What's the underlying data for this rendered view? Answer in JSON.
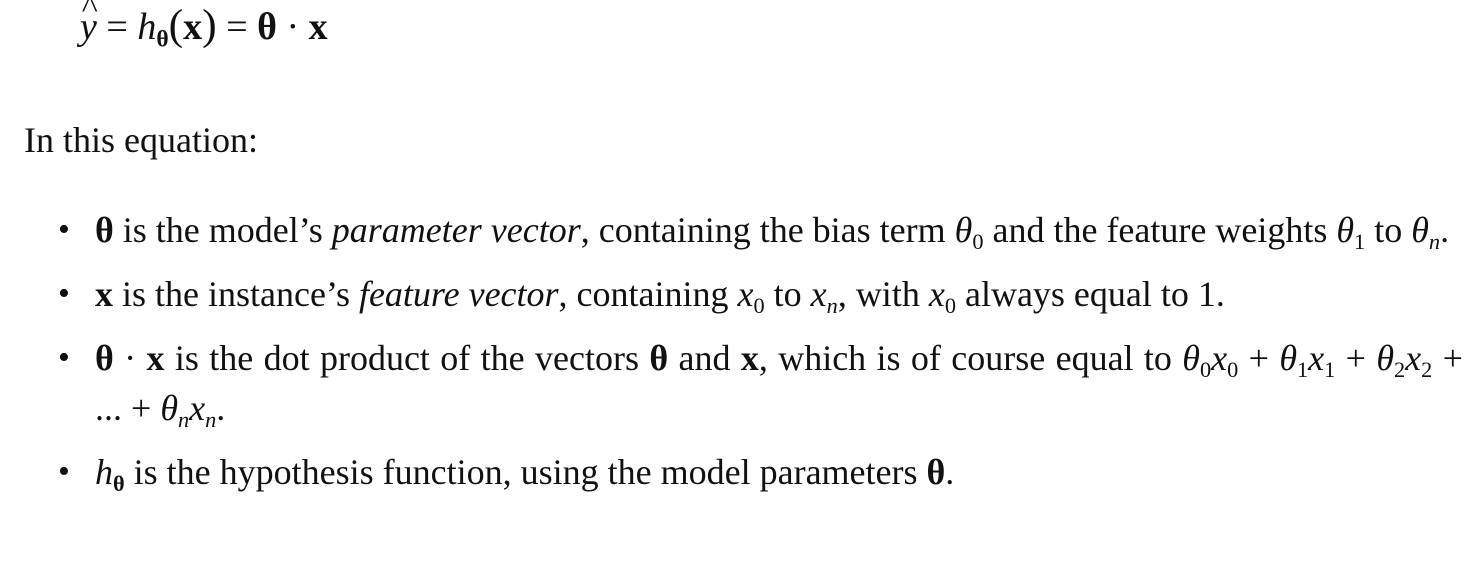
{
  "equation": {
    "y_hat": "y",
    "hat_mark": "^",
    "eq1": " = ",
    "h": "h",
    "h_sub": "θ",
    "open_paren": "(",
    "x": "x",
    "close_paren": ")",
    "eq2": " = ",
    "theta": "θ",
    "dot": " · ",
    "x2": "x"
  },
  "intro": "In this equation:",
  "bullet_symbol": "•",
  "bullets": [
    {
      "theta": "θ",
      "t1": " is the model’s ",
      "em": "parameter vector",
      "t2": ", containing the bias term ",
      "v1": "θ",
      "s1": "0",
      "t3": " and the feature weights ",
      "v2": "θ",
      "s2": "1",
      "t4": " to ",
      "v3": "θ",
      "s3": "n",
      "t5": "."
    },
    {
      "x": "x",
      "t1": " is the instance’s ",
      "em": "feature vector",
      "t2": ", containing ",
      "v1": "x",
      "s1": "0",
      "t3": " to ",
      "v2": "x",
      "s2": "n",
      "t4": ", with ",
      "v3": "x",
      "s3": "0",
      "t5": " always equal to 1."
    },
    {
      "theta": "θ",
      "dot": " · ",
      "x": "x",
      "t1": " is the dot product of the vectors ",
      "theta2": "θ",
      "t2": " and ",
      "x2": "x",
      "t3": ", which is of course equal to ",
      "a_t": "θ",
      "a_ts": "0",
      "a_x": "x",
      "a_xs": "0",
      "p1": " + ",
      "b_t": "θ",
      "b_ts": "1",
      "b_x": "x",
      "b_xs": "1",
      "p2": " + ",
      "c_t": "θ",
      "c_ts": "2",
      "c_x": "x",
      "c_xs": "2",
      "p3": " + ... + ",
      "d_t": "θ",
      "d_ts": "n",
      "d_x": "x",
      "d_xs": "n",
      "t4": "."
    },
    {
      "h": "h",
      "h_sub": "θ",
      "t1": " is the hypothesis function, using the model parameters ",
      "theta": "θ",
      "t2": "."
    }
  ]
}
